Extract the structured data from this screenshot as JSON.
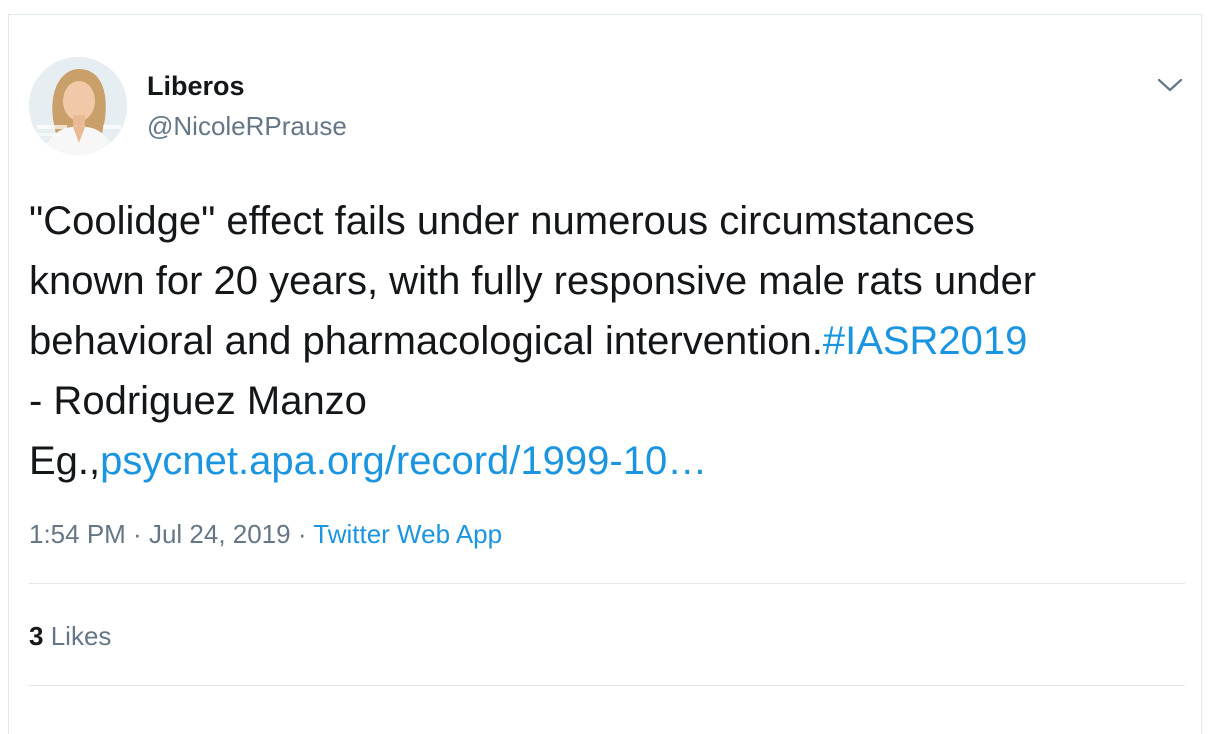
{
  "tweet": {
    "author": {
      "name": "Liberos",
      "handle": "@NicoleRPrause"
    },
    "text": {
      "line1": "\"Coolidge\" effect fails under numerous circumstances",
      "line2": "known for 20 years, with fully responsive male rats under",
      "line3_text": "behavioral and pharmacological intervention.",
      "hashtag": "#IASR2019",
      "line4": "- Rodriguez Manzo",
      "line5_prefix": "Eg.,",
      "link": "psycnet.apa.org/record/1999-10…"
    },
    "meta": {
      "time": "1:54 PM",
      "separator1": " · ",
      "date": "Jul 24, 2019",
      "separator2": " · ",
      "source": "Twitter Web App"
    },
    "stats": {
      "likes_count": "3",
      "likes_label": "Likes"
    }
  },
  "colors": {
    "text": "#14171a",
    "secondary": "#657786",
    "link": "#1b95e0",
    "border": "#e1e8ed"
  },
  "icons": {
    "caret": "chevron-down-icon"
  }
}
